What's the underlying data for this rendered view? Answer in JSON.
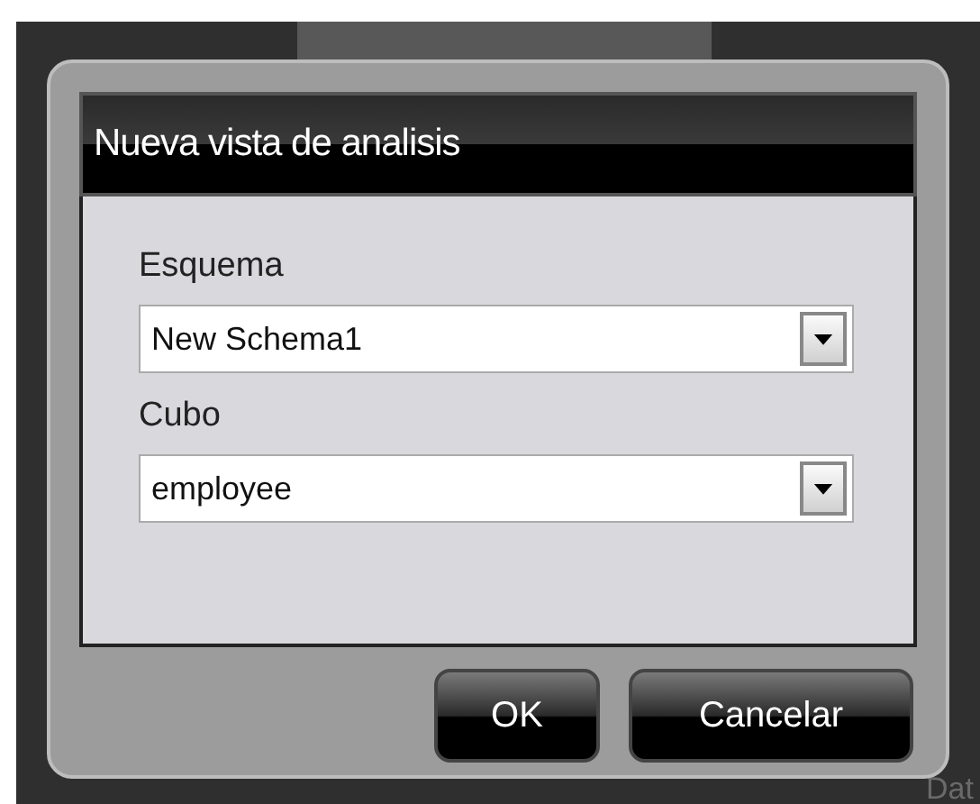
{
  "dialog": {
    "title": "Nueva vista de analisis",
    "fields": [
      {
        "label": "Esquema",
        "value": "New Schema1"
      },
      {
        "label": "Cubo",
        "value": "employee"
      }
    ],
    "buttons": [
      "OK",
      "Cancelar"
    ]
  },
  "background_label": "Dat"
}
